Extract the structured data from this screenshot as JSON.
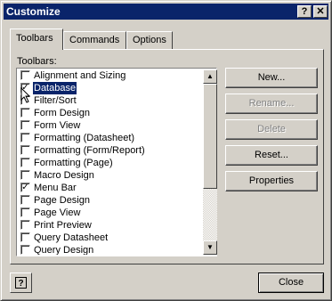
{
  "window": {
    "title": "Customize",
    "help_btn": "?",
    "close_btn": "✕"
  },
  "tabs": [
    {
      "label": "Toolbars"
    },
    {
      "label": "Commands"
    },
    {
      "label": "Options"
    }
  ],
  "toolbars_label": "Toolbars:",
  "toolbar_list": [
    {
      "label": "Alignment and Sizing",
      "checked": false
    },
    {
      "label": "Database",
      "checked": true,
      "selected": true
    },
    {
      "label": "Filter/Sort",
      "checked": false
    },
    {
      "label": "Form Design",
      "checked": false
    },
    {
      "label": "Form View",
      "checked": false
    },
    {
      "label": "Formatting (Datasheet)",
      "checked": false
    },
    {
      "label": "Formatting (Form/Report)",
      "checked": false
    },
    {
      "label": "Formatting (Page)",
      "checked": false
    },
    {
      "label": "Macro Design",
      "checked": false
    },
    {
      "label": "Menu Bar",
      "checked": true
    },
    {
      "label": "Page Design",
      "checked": false
    },
    {
      "label": "Page View",
      "checked": false
    },
    {
      "label": "Print Preview",
      "checked": false
    },
    {
      "label": "Query Datasheet",
      "checked": false
    },
    {
      "label": "Query Design",
      "checked": false
    }
  ],
  "buttons": {
    "new": "New...",
    "rename": "Rename...",
    "delete": "Delete",
    "reset": "Reset...",
    "properties": "Properties",
    "close": "Close"
  },
  "scroll_position": 0
}
